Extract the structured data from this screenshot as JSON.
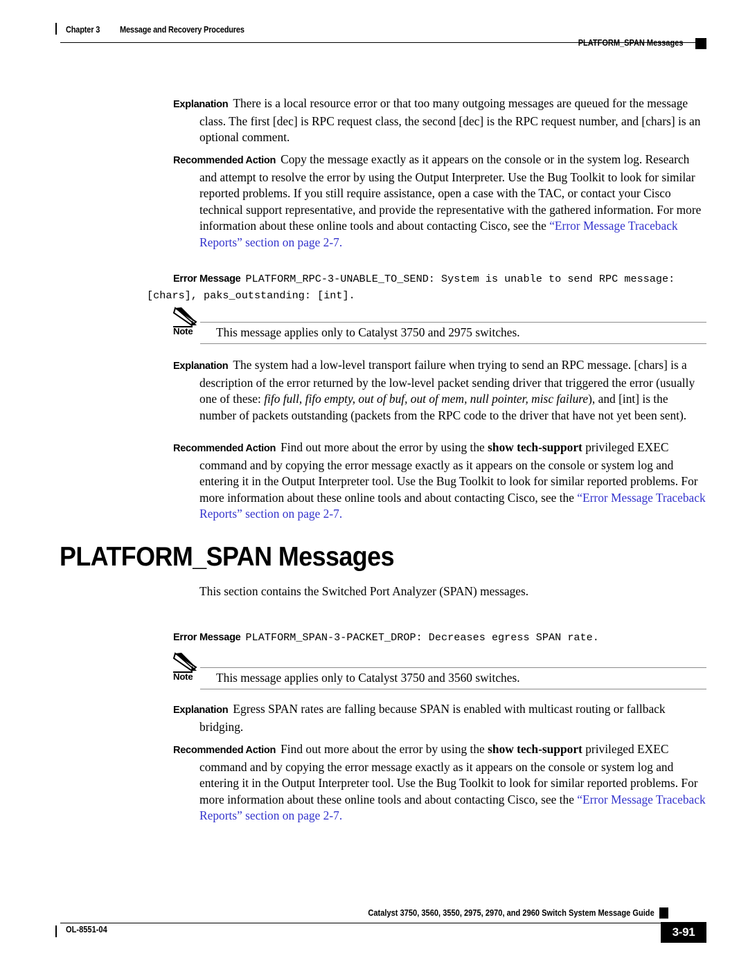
{
  "header": {
    "chapter": "Chapter 3",
    "chapter_title": "Message and Recovery Procedures",
    "running_head": "PLATFORM_SPAN Messages"
  },
  "footer": {
    "doc_id": "OL-8551-04",
    "guide_title": "Catalyst 3750, 3560, 3550, 2975, 2970, and 2960 Switch System Message Guide",
    "page_number": "3-91"
  },
  "colors": {
    "link": "#3333cc",
    "rule": "#8c8c8c",
    "text": "#000000"
  },
  "blocks": {
    "explanation_1": {
      "label": "Explanation",
      "text": "There is a local resource error or that too many outgoing messages are queued for the message class. The first [dec] is RPC request class, the second [dec] is the RPC request number, and [chars] is an optional comment."
    },
    "recommended_action_1": {
      "label": "Recommended Action",
      "text_before_link": "Copy the message exactly as it appears on the console or in the system log. Research and attempt to resolve the error by using the Output Interpreter. Use the Bug Toolkit to look for similar reported problems. If you still require assistance, open a case with the TAC, or contact your Cisco technical support representative, and provide the representative with the gathered information. For more information about these online tools and about contacting Cisco, see the ",
      "link_text": "“Error Message Traceback Reports” section on page 2-7",
      "text_after_link": "."
    },
    "error_message_1": {
      "label": "Error Message",
      "line1": "PLATFORM_RPC-3-UNABLE_TO_SEND: System is unable to send RPC message:",
      "line2": "[chars], paks_outstanding: [int]."
    },
    "note_1": {
      "label": "Note",
      "icon": "pencil-icon",
      "text": "This message applies only to Catalyst 3750 and 2975 switches."
    },
    "explanation_2": {
      "label": "Explanation",
      "part1": "The system had a low-level transport failure when trying to send an RPC message. [chars] is a description of the error returned by the low-level packet sending driver that triggered the error (usually one of these: ",
      "italic": "fifo full, fifo empty, out of buf, out of mem, null pointer, misc failure",
      "part2": "), and [int] is the number of packets outstanding (packets from the RPC code to the driver that have not yet been sent)."
    },
    "recommended_action_2": {
      "label": "Recommended Action",
      "part1": "Find out more about the error by using the ",
      "bold_cmd": "show tech-support",
      "part2": " privileged EXEC command and by copying the error message exactly as it appears on the console or system log and entering it in the Output Interpreter tool. Use the Bug Toolkit to look for similar reported problems. For more information about these online tools and about contacting Cisco, see the ",
      "link_text": "“Error Message Traceback Reports” section on page 2-7",
      "part3": "."
    },
    "section_heading": "PLATFORM_SPAN Messages",
    "section_intro": "This section contains the Switched Port Analyzer (SPAN) messages.",
    "error_message_2": {
      "label": "Error Message",
      "line1": "PLATFORM_SPAN-3-PACKET_DROP: Decreases egress SPAN rate."
    },
    "note_2": {
      "label": "Note",
      "icon": "pencil-icon",
      "text": "This message applies only to Catalyst 3750 and 3560 switches."
    },
    "explanation_3": {
      "label": "Explanation",
      "text": "Egress SPAN rates are falling because SPAN is enabled with multicast routing or fallback bridging."
    },
    "recommended_action_3": {
      "label": "Recommended Action",
      "part1": "Find out more about the error by using the ",
      "bold_cmd": "show tech-support",
      "part2": " privileged EXEC command and by copying the error message exactly as it appears on the console or system log and entering it in the Output Interpreter tool. Use the Bug Toolkit to look for similar reported problems. For more information about these online tools and about contacting Cisco, see the ",
      "link_text": "“Error Message Traceback Reports” section on page 2-7",
      "part3": "."
    }
  }
}
